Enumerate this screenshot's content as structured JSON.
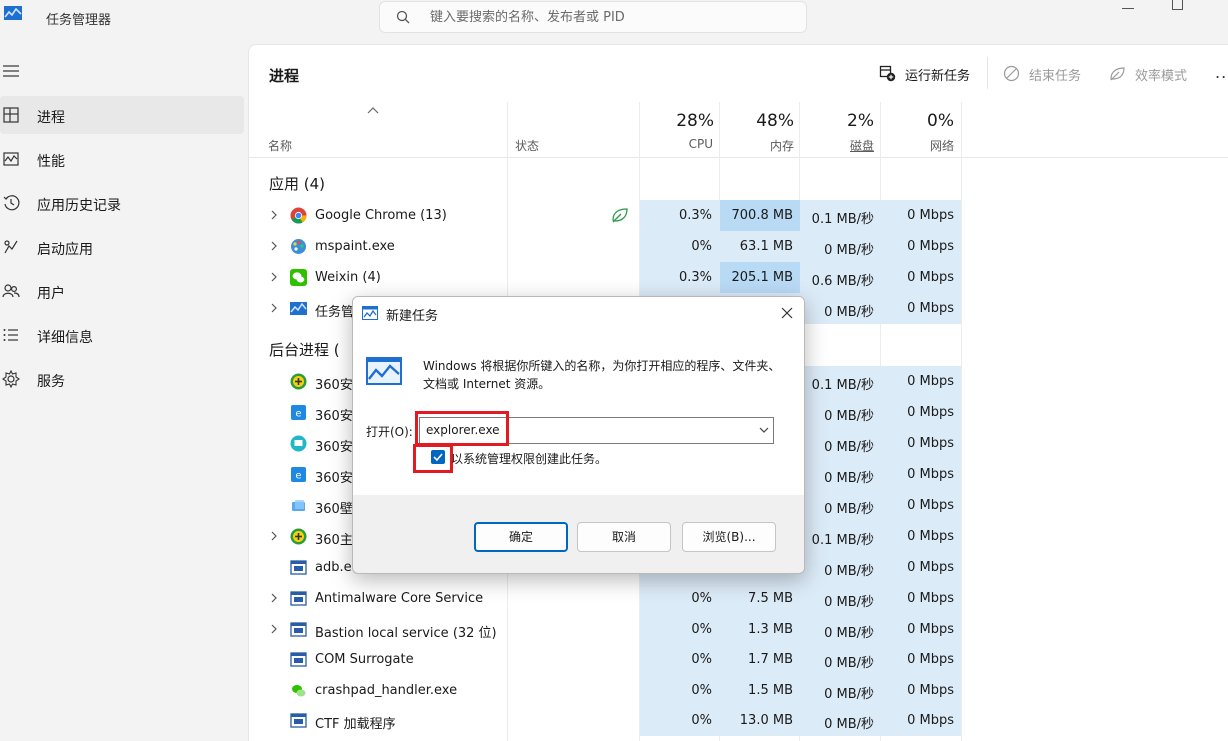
{
  "titlebar": {
    "app_title": "任务管理器",
    "search_placeholder": "键入要搜索的名称、发布者或 PID"
  },
  "sidebar": {
    "items": [
      {
        "label": "进程",
        "icon": "processes-icon",
        "active": true
      },
      {
        "label": "性能",
        "icon": "performance-icon"
      },
      {
        "label": "应用历史记录",
        "icon": "app-history-icon"
      },
      {
        "label": "启动应用",
        "icon": "startup-apps-icon"
      },
      {
        "label": "用户",
        "icon": "users-icon"
      },
      {
        "label": "详细信息",
        "icon": "details-icon"
      },
      {
        "label": "服务",
        "icon": "services-icon"
      }
    ]
  },
  "main": {
    "title": "进程",
    "commands": {
      "run_new_task": "运行新任务",
      "end_task": "结束任务",
      "efficiency_mode": "效率模式",
      "more": "..."
    },
    "columns": {
      "name": "名称",
      "status": "状态",
      "cpu_pct": "28%",
      "cpu": "CPU",
      "mem_pct": "48%",
      "mem": "内存",
      "disk_pct": "2%",
      "disk": "磁盘",
      "net_pct": "0%",
      "net": "网络"
    },
    "groups": {
      "apps": "应用 (4)",
      "background": "后台进程 ("
    },
    "rows": [
      {
        "name": "Google Chrome (13)",
        "cpu": "0.3%",
        "mem": "700.8 MB",
        "disk": "0.1 MB/秒",
        "net": "0 Mbps"
      },
      {
        "name": "mspaint.exe",
        "cpu": "0%",
        "mem": "63.1 MB",
        "disk": "0 MB/秒",
        "net": "0 Mbps"
      },
      {
        "name": "Weixin (4)",
        "cpu": "0.3%",
        "mem": "205.1 MB",
        "disk": "0.6 MB/秒",
        "net": "0 Mbps"
      },
      {
        "name": "任务管",
        "cpu": "",
        "mem": "",
        "disk": "0 MB/秒",
        "net": "0 Mbps"
      },
      {
        "name": "360安",
        "cpu": "",
        "mem": "",
        "disk": "0.1 MB/秒",
        "net": "0 Mbps"
      },
      {
        "name": "360安",
        "cpu": "",
        "mem": "",
        "disk": "0 MB/秒",
        "net": "0 Mbps"
      },
      {
        "name": "360安",
        "cpu": "",
        "mem": "",
        "disk": "0 MB/秒",
        "net": "0 Mbps"
      },
      {
        "name": "360安",
        "cpu": "",
        "mem": "",
        "disk": "0 MB/秒",
        "net": "0 Mbps"
      },
      {
        "name": "360壁",
        "cpu": "",
        "mem": "",
        "disk": "0 MB/秒",
        "net": "0 Mbps"
      },
      {
        "name": "360主",
        "cpu": "",
        "mem": "",
        "disk": "0.1 MB/秒",
        "net": "0 Mbps"
      },
      {
        "name": "adb.e",
        "cpu": "",
        "mem": "",
        "disk": "0 MB/秒",
        "net": "0 Mbps"
      },
      {
        "name": "Antimalware Core Service",
        "cpu": "0%",
        "mem": "7.5 MB",
        "disk": "0 MB/秒",
        "net": "0 Mbps"
      },
      {
        "name": "Bastion local service (32 位)",
        "cpu": "0%",
        "mem": "1.3 MB",
        "disk": "0 MB/秒",
        "net": "0 Mbps"
      },
      {
        "name": "COM Surrogate",
        "cpu": "0%",
        "mem": "1.7 MB",
        "disk": "0 MB/秒",
        "net": "0 Mbps"
      },
      {
        "name": "crashpad_handler.exe",
        "cpu": "0%",
        "mem": "1.5 MB",
        "disk": "0 MB/秒",
        "net": "0 Mbps"
      },
      {
        "name": "CTF 加载程序",
        "cpu": "0%",
        "mem": "13.0 MB",
        "disk": "0 MB/秒",
        "net": "0 Mbps"
      }
    ]
  },
  "dialog": {
    "title": "新建任务",
    "description": "Windows 将根据你所键入的名称，为你打开相应的程序、文件夹、文档或 Internet 资源。",
    "open_label": "打开(O):",
    "open_value": "explorer.exe",
    "admin_checkbox_label": "以系统管理权限创建此任务。",
    "admin_checked": true,
    "ok": "确定",
    "cancel": "取消",
    "browse": "浏览(B)..."
  },
  "colors": {
    "accent": "#0067c0",
    "highlight_red": "#e21b22",
    "heat_light": "#dcebf8",
    "heat_mid": "#bcdcf4"
  }
}
